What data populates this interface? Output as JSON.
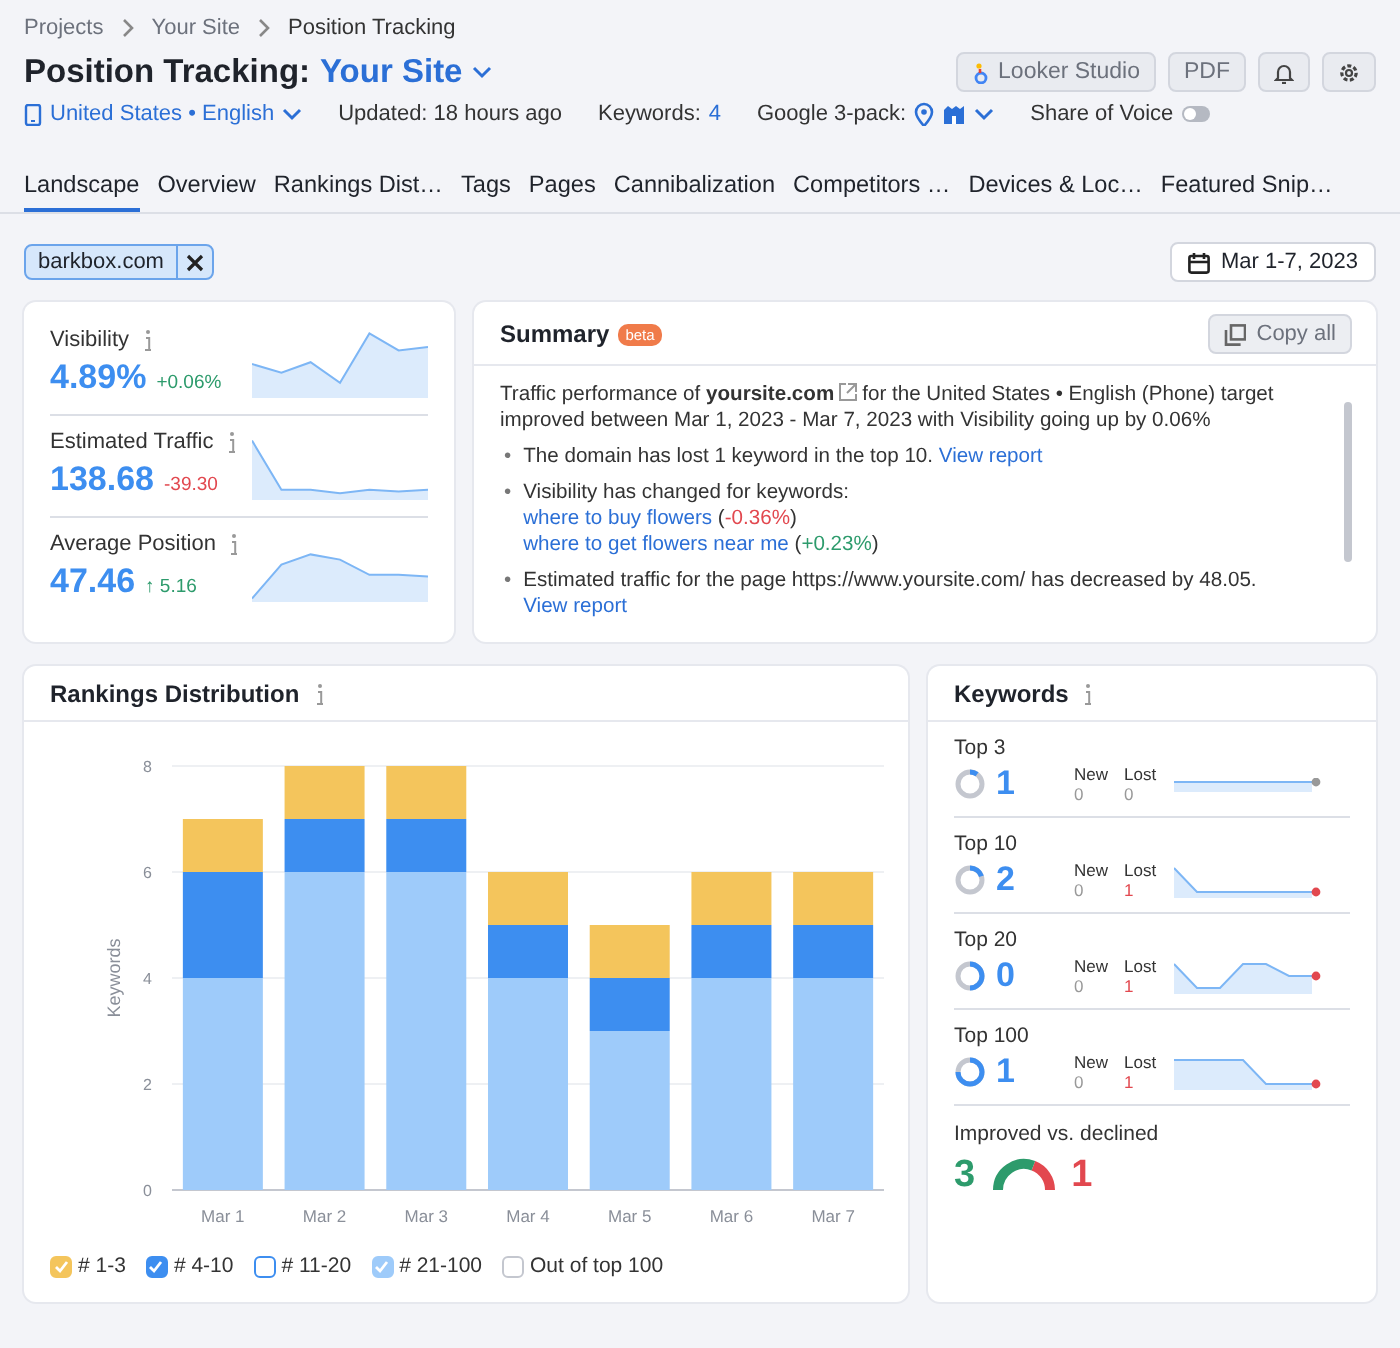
{
  "breadcrumbs": [
    "Projects",
    "Your Site",
    "Position Tracking"
  ],
  "title": {
    "prefix": "Position Tracking:",
    "site": "Your Site"
  },
  "toolbar_buttons": [
    {
      "kind": "looker",
      "label": "Looker Studio"
    },
    {
      "kind": "text",
      "label": "PDF"
    },
    {
      "kind": "bell"
    },
    {
      "kind": "gear"
    }
  ],
  "info_bar": {
    "location": "United States • English",
    "updated": "Updated: 18 hours ago",
    "keywords_label": "Keywords:",
    "keywords_value": "4",
    "google_3pack_label": "Google 3-pack:",
    "share_of_voice": {
      "label": "Share of Voice",
      "on": false
    }
  },
  "tabs": [
    {
      "label": "Landscape",
      "selected": true
    },
    {
      "label": "Overview",
      "selected": false
    },
    {
      "label": "Rankings Dist…",
      "selected": false
    },
    {
      "label": "Tags",
      "selected": false
    },
    {
      "label": "Pages",
      "selected": false
    },
    {
      "label": "Cannibalization",
      "selected": false
    },
    {
      "label": "Competitors …",
      "selected": false
    },
    {
      "label": "Devices & Loc…",
      "selected": false
    },
    {
      "label": "Featured Snip…",
      "selected": false
    }
  ],
  "filter_tag": "barkbox.com",
  "date_range": "Mar 1-7, 2023",
  "metrics": [
    {
      "label": "Visibility",
      "value": "4.89%",
      "change": "+0.06%",
      "color": "#2d9b6c"
    },
    {
      "label": "Estimated Traffic",
      "value": "138.68",
      "change": "-39.30",
      "color": "#e2484f"
    },
    {
      "label": "Average Position",
      "value": "47.46",
      "change": "↑ 5.16",
      "color": "#2d9b6c"
    }
  ],
  "summary": {
    "title": "Summary",
    "badge": "beta",
    "copy_button": "Copy all",
    "intro_start": "Traffic performance of **yoursite.com**",
    "intro_end": "for the United States • English (Phone) target improved between Mar 1, 2023 - Mar 7, 2023 with Visibility going up by 0.06%",
    "bullets": [
      {
        "marker": "•",
        "text": "The domain has lost 1 keyword in the top 10.",
        "link": "View report"
      },
      {
        "marker": "•",
        "text": "Visibility has changed for keywords:",
        "keywords": [
          {
            "keyword": "where to buy flowers",
            "open": "(",
            "change": "-0.36%",
            "close": ")",
            "color": "#e2484f"
          },
          {
            "keyword": "where to get flowers near me",
            "open": "(",
            "change": "+0.23%",
            "close": ")",
            "color": "#2d9b6c"
          }
        ]
      },
      {
        "marker": "•",
        "text": "Estimated traffic for the page https://www.yoursite.com/ has decreased by 48.05.",
        "link": "View report"
      }
    ]
  },
  "rankings": {
    "chart_data": {
      "type": "bar",
      "title": "Rankings Distribution",
      "ylabel": "Keywords",
      "categories": [
        "Mar 1",
        "Mar 2",
        "Mar 3",
        "Mar 4",
        "Mar 5",
        "Mar 6",
        "Mar 7"
      ],
      "stacked": true,
      "grid": true,
      "ylim": [
        0,
        8
      ],
      "yticks": [
        0,
        2,
        4,
        6,
        8
      ],
      "series": [
        {
          "name": "# 1-3",
          "color": "#f4c55c",
          "values": [
            1,
            1,
            1,
            1,
            1,
            1,
            1
          ]
        },
        {
          "name": "# 4-10",
          "color": "#3d8ef0",
          "values": [
            2,
            1,
            1,
            1,
            1,
            1,
            1
          ]
        },
        {
          "name": "# 11-20",
          "color": "#3d8ef0",
          "values": [
            0,
            0,
            0,
            0,
            0,
            0,
            0
          ]
        },
        {
          "name": "# 21-100",
          "color": "#9ecbfa",
          "values": [
            4,
            6,
            6,
            4,
            3,
            4,
            4
          ]
        },
        {
          "name": "Out of top 100",
          "color": "#c4c7cf",
          "values": [
            0,
            0,
            0,
            0,
            0,
            0,
            0
          ]
        }
      ]
    },
    "legend": [
      {
        "checked": true
      },
      {
        "checked": true
      },
      {
        "checked": false
      },
      {
        "checked": true
      },
      {
        "checked": false
      }
    ]
  },
  "keywords": {
    "title": "Keywords",
    "groups": [
      {
        "label": "Top 3",
        "count": "1",
        "new_label": "New",
        "new": "0",
        "lost_label": "Lost",
        "lost": "0",
        "lost_negative": false
      },
      {
        "label": "Top 10",
        "count": "2",
        "new_label": "New",
        "new": "0",
        "lost_label": "Lost",
        "lost": "1",
        "lost_negative": true
      },
      {
        "label": "Top 20",
        "count": "0",
        "new_label": "New",
        "new": "0",
        "lost_label": "Lost",
        "lost": "1",
        "lost_negative": true
      },
      {
        "label": "Top 100",
        "count": "1",
        "new_label": "New",
        "new": "0",
        "lost_label": "Lost",
        "lost": "1",
        "lost_negative": true
      }
    ],
    "improved_label": "Improved vs. declined",
    "improved": "3",
    "declined": "1",
    "level": 0.68
  }
}
